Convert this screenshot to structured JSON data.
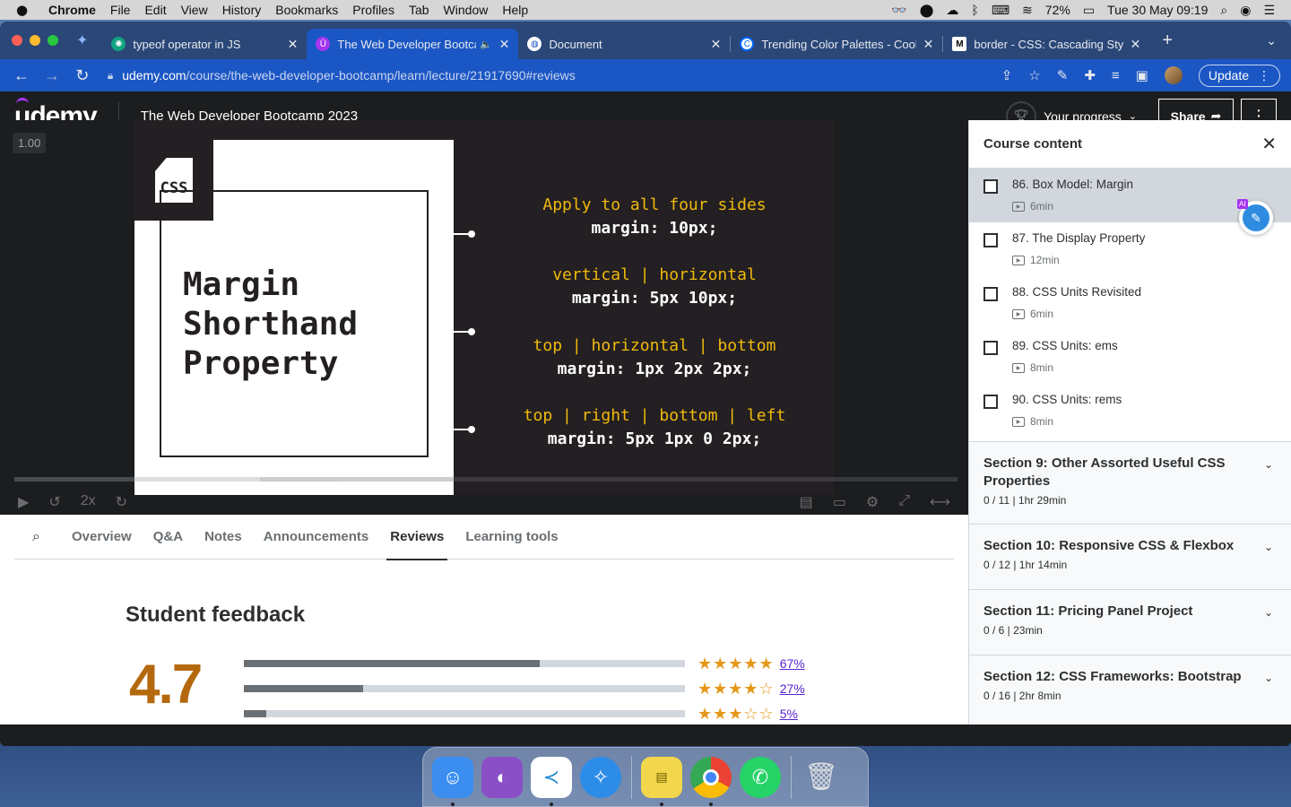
{
  "menubar": {
    "app_name": "Chrome",
    "items": [
      "File",
      "Edit",
      "View",
      "History",
      "Bookmarks",
      "Profiles",
      "Tab",
      "Window",
      "Help"
    ],
    "battery": "72%",
    "datetime": "Tue 30 May  09:19"
  },
  "browser": {
    "tabs": [
      {
        "title": "typeof operator in JS",
        "favicon": "chatgpt-icon",
        "color": "#10a37f"
      },
      {
        "title": "The Web Developer Bootca",
        "favicon": "udemy-icon",
        "color": "#a435f0"
      },
      {
        "title": "Document",
        "favicon": "globe-icon",
        "color": "#5f6368"
      },
      {
        "title": "Trending Color Palettes - Coolo",
        "favicon": "coolors-icon",
        "color": "#0066ff"
      },
      {
        "title": "border - CSS: Cascading Style",
        "favicon": "mdn-icon",
        "color": "#000000"
      }
    ],
    "url_host": "udemy.com",
    "url_path": "/course/the-web-developer-bootcamp/learn/lecture/21917690#reviews",
    "update_label": "Update"
  },
  "header": {
    "logo": "udemy",
    "course_title": "The Web Developer Bootcamp 2023",
    "progress_label": "Your progress",
    "share_label": "Share"
  },
  "video": {
    "speed": "1.00",
    "slide": {
      "badge": "CSS",
      "title_lines": [
        "Margin",
        "Shorthand",
        "Property"
      ],
      "rules": [
        {
          "label": "Apply to all four sides",
          "code": "margin: 10px;"
        },
        {
          "label": "vertical | horizontal",
          "code": "margin: 5px 10px;"
        },
        {
          "label": "top | horizontal | bottom",
          "code": "margin: 1px 2px 2px;"
        },
        {
          "label": "top | right | bottom | left",
          "code": "margin: 5px 1px 0 2px;"
        }
      ]
    },
    "playback_rate": "2x",
    "progress_fraction": 0.26
  },
  "course_tabs": [
    "Overview",
    "Q&A",
    "Notes",
    "Announcements",
    "Reviews",
    "Learning tools"
  ],
  "active_tab": "Reviews",
  "feedback": {
    "title": "Student feedback",
    "average": "4.7",
    "rows": [
      {
        "stars": "★★★★★",
        "pct": "67%",
        "fraction": 0.67
      },
      {
        "stars": "★★★★☆",
        "pct": "27%",
        "fraction": 0.27
      },
      {
        "stars": "★★★☆☆",
        "pct": "5%",
        "fraction": 0.05
      }
    ]
  },
  "sidebar": {
    "title": "Course content",
    "lectures": [
      {
        "title": "86. Box Model: Margin",
        "duration": "6min",
        "current": true
      },
      {
        "title": "87. The Display Property",
        "duration": "12min",
        "current": false
      },
      {
        "title": "88. CSS Units Revisited",
        "duration": "6min",
        "current": false
      },
      {
        "title": "89. CSS Units: ems",
        "duration": "8min",
        "current": false
      },
      {
        "title": "90. CSS Units: rems",
        "duration": "8min",
        "current": false
      }
    ],
    "ai_badge": "AI",
    "sections": [
      {
        "title": "Section 9: Other Assorted Useful CSS Properties",
        "meta": "0 / 11 | 1hr 29min"
      },
      {
        "title": "Section 10: Responsive CSS & Flexbox",
        "meta": "0 / 12 | 1hr 14min"
      },
      {
        "title": "Section 11: Pricing Panel Project",
        "meta": "0 / 6 | 23min"
      },
      {
        "title": "Section 12: CSS Frameworks: Bootstrap",
        "meta": "0 / 16 | 2hr 8min"
      }
    ]
  },
  "dock": {
    "apps": [
      {
        "name": "finder-icon",
        "color": "#3b8ef0",
        "running": true
      },
      {
        "name": "github-desktop-icon",
        "color": "#8a4fc7",
        "running": false
      },
      {
        "name": "vscode-icon",
        "color": "#1f8ad2",
        "running": true
      },
      {
        "name": "safari-icon",
        "color": "#2d8ce8",
        "running": false
      },
      {
        "name": "stickies-icon",
        "color": "#f2d64b",
        "running": true
      },
      {
        "name": "chrome-icon",
        "color": "#ffffff",
        "running": true
      },
      {
        "name": "whatsapp-icon",
        "color": "#25d366",
        "running": false
      },
      {
        "name": "trash-icon",
        "color": "#b7b9bd",
        "running": false
      }
    ]
  }
}
